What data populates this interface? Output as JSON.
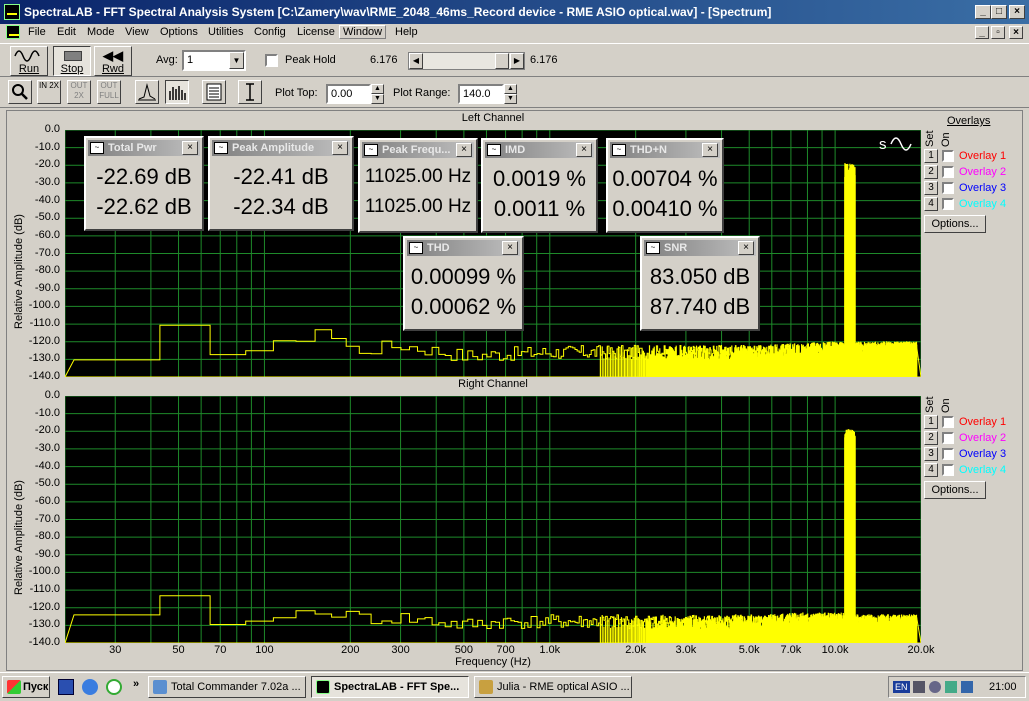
{
  "window": {
    "title": "SpectraLAB - FFT Spectral Analysis System [C:\\Zamery\\wav\\RME_2048_46ms_Record device - RME ASIO optical.wav] - [Spectrum]"
  },
  "menu": [
    "File",
    "Edit",
    "Mode",
    "View",
    "Options",
    "Utilities",
    "Config",
    "License",
    "Window",
    "Help"
  ],
  "toolbar": {
    "run_label": "Run",
    "stop_label": "Stop",
    "rwd_label": "Rwd",
    "avg_label": "Avg:",
    "avg_value": "1",
    "peak_hold_label": "Peak Hold",
    "slider_left_value": "6.176",
    "slider_right_value": "6.176",
    "plot_top_label": "Plot Top:",
    "plot_top_value": "0.00",
    "plot_range_label": "Plot Range:",
    "plot_range_value": "140.0",
    "zoom_buttons": [
      "IN 2X",
      "OUT 2X",
      "OUT FULL"
    ]
  },
  "overlays": {
    "title": "Overlays",
    "set_label": "Set",
    "on_label": "On",
    "items": [
      {
        "num": "1",
        "label": "Overlay 1",
        "color": "#ff0000"
      },
      {
        "num": "2",
        "label": "Overlay 2",
        "color": "#ff00ff"
      },
      {
        "num": "3",
        "label": "Overlay 3",
        "color": "#0000ff"
      },
      {
        "num": "4",
        "label": "Overlay 4",
        "color": "#00ffff"
      }
    ],
    "options_label": "Options..."
  },
  "meters": [
    {
      "title": "Total Pwr",
      "v1": "-22.69 dB",
      "v2": "-22.62 dB"
    },
    {
      "title": "Peak Amplitude",
      "v1": "-22.41 dB",
      "v2": "-22.34 dB"
    },
    {
      "title": "Peak Frequ...",
      "v1": "11025.00 Hz",
      "v2": "11025.00 Hz"
    },
    {
      "title": "IMD",
      "v1": "0.0019 %",
      "v2": "0.0011 %"
    },
    {
      "title": "THD+N",
      "v1": "0.00704 %",
      "v2": "0.00410 %"
    },
    {
      "title": "THD",
      "v1": "0.00099 %",
      "v2": "0.00062 %"
    },
    {
      "title": "SNR",
      "v1": "83.050 dB",
      "v2": "87.740 dB"
    }
  ],
  "chart_data": [
    {
      "type": "line",
      "title": "Left Channel",
      "xlabel": "",
      "ylabel": "Relative Amplitude (dB)",
      "ylim": [
        -140,
        0
      ],
      "xlim": [
        20,
        20000
      ],
      "xscale": "log",
      "yticks": [
        "0.0",
        "-10.0",
        "-20.0",
        "-30.0",
        "-40.0",
        "-50.0",
        "-60.0",
        "-70.0",
        "-80.0",
        "-90.0",
        "-100.0",
        "-110.0",
        "-120.0",
        "-130.0",
        "-140.0"
      ],
      "grid": true,
      "color": "#ffff00",
      "series": [
        {
          "x": [
            20,
            30,
            40,
            50,
            60,
            70,
            80,
            100,
            150,
            200,
            300,
            500,
            700,
            1000,
            2000,
            3000,
            5000,
            7000,
            10000,
            11025,
            12000,
            15000,
            20000
          ],
          "y": [
            -132,
            -140,
            -115,
            -112,
            -122,
            -126,
            -124,
            -125,
            -112,
            -125,
            -122,
            -128,
            -127,
            -126,
            -126,
            -126,
            -126,
            -125,
            -124,
            -23,
            -124,
            -124,
            -124
          ]
        }
      ]
    },
    {
      "type": "line",
      "title": "Right Channel",
      "xlabel": "Frequency (Hz)",
      "ylabel": "Relative Amplitude (dB)",
      "ylim": [
        -140,
        0
      ],
      "xlim": [
        20,
        20000
      ],
      "xscale": "log",
      "yticks": [
        "0.0",
        "-10.0",
        "-20.0",
        "-30.0",
        "-40.0",
        "-50.0",
        "-60.0",
        "-70.0",
        "-80.0",
        "-90.0",
        "-100.0",
        "-110.0",
        "-120.0",
        "-130.0",
        "-140.0"
      ],
      "xticks": [
        "30",
        "50",
        "70",
        "100",
        "200",
        "300",
        "500",
        "700",
        "1.0k",
        "2.0k",
        "3.0k",
        "5.0k",
        "7.0k",
        "10.0k",
        "20.0k"
      ],
      "grid": true,
      "color": "#ffff00",
      "series": [
        {
          "x": [
            20,
            30,
            40,
            50,
            60,
            70,
            80,
            100,
            150,
            200,
            300,
            500,
            700,
            1000,
            2000,
            3000,
            5000,
            7000,
            10000,
            11025,
            12000,
            15000,
            20000
          ],
          "y": [
            -124,
            -140,
            -118,
            -115,
            -124,
            -130,
            -128,
            -128,
            -120,
            -126,
            -126,
            -130,
            -128,
            -128,
            -128,
            -128,
            -128,
            -127,
            -127,
            -23,
            -128,
            -128,
            -128
          ]
        }
      ]
    }
  ],
  "taskbar": {
    "start_label": "Пуск",
    "tasks": [
      "Total Commander 7.02a ...",
      "SpectraLAB - FFT Spe...",
      "Julia - RME optical ASIO ..."
    ],
    "lang": "EN",
    "clock": "21:00"
  }
}
